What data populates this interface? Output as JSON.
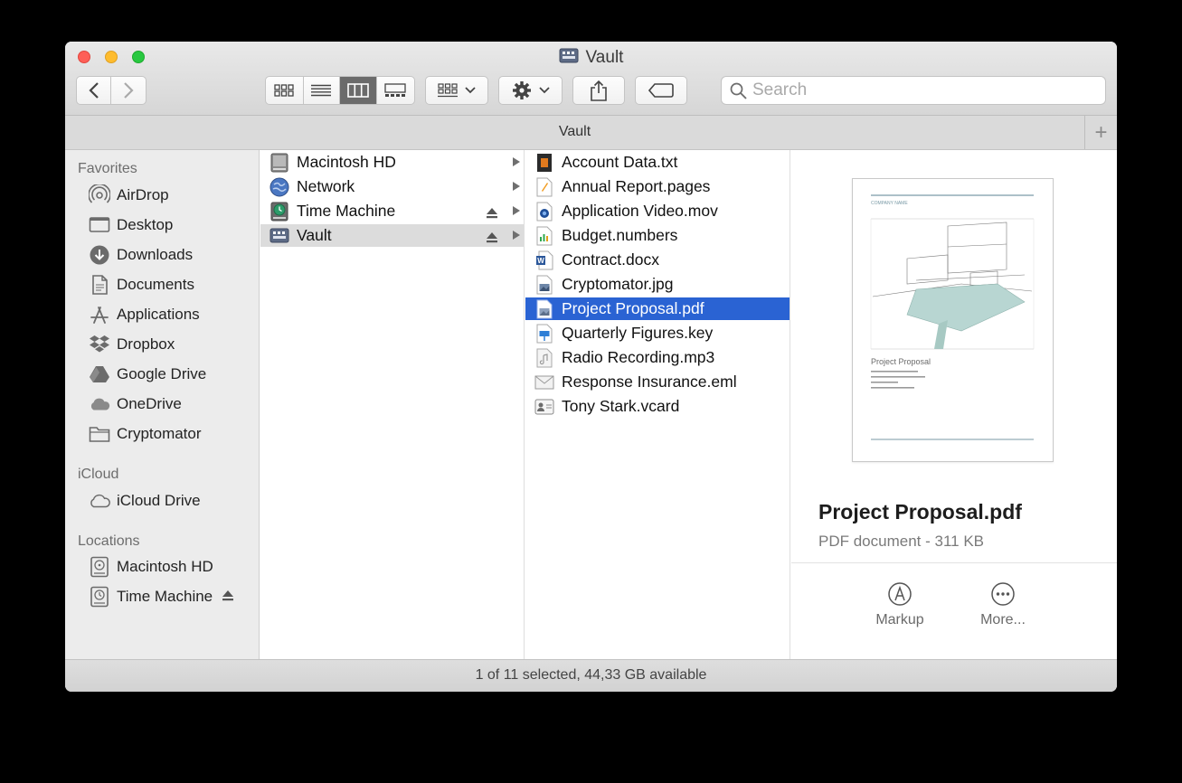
{
  "window": {
    "title": "Vault"
  },
  "toolbar": {
    "search_placeholder": "Search",
    "view_modes": [
      "icon-view",
      "list-view",
      "column-view",
      "gallery-view"
    ],
    "active_view": "column-view"
  },
  "pathbar": {
    "title": "Vault",
    "add_label": "+"
  },
  "sidebar": {
    "sections": [
      {
        "header": "Favorites",
        "items": [
          {
            "label": "AirDrop",
            "icon": "airdrop-icon"
          },
          {
            "label": "Desktop",
            "icon": "desktop-icon"
          },
          {
            "label": "Downloads",
            "icon": "downloads-icon"
          },
          {
            "label": "Documents",
            "icon": "documents-icon"
          },
          {
            "label": "Applications",
            "icon": "applications-icon"
          },
          {
            "label": "Dropbox",
            "icon": "dropbox-icon"
          },
          {
            "label": "Google Drive",
            "icon": "google-drive-icon"
          },
          {
            "label": "OneDrive",
            "icon": "onedrive-icon"
          },
          {
            "label": "Cryptomator",
            "icon": "folder-icon"
          }
        ]
      },
      {
        "header": "iCloud",
        "items": [
          {
            "label": "iCloud Drive",
            "icon": "icloud-icon"
          }
        ]
      },
      {
        "header": "Locations",
        "items": [
          {
            "label": "Macintosh HD",
            "icon": "hard-drive-icon"
          },
          {
            "label": "Time Machine",
            "icon": "time-machine-icon"
          }
        ]
      }
    ]
  },
  "columns": {
    "volumes": [
      {
        "label": "Macintosh HD",
        "icon": "hard-drive-icon",
        "eject": false
      },
      {
        "label": "Network",
        "icon": "network-icon",
        "eject": false
      },
      {
        "label": "Time Machine",
        "icon": "time-machine-icon",
        "eject": true
      },
      {
        "label": "Vault",
        "icon": "vault-drive-icon",
        "eject": true,
        "selected": true
      }
    ],
    "files": [
      {
        "label": "Account Data.txt",
        "icon": "text-file-icon"
      },
      {
        "label": "Annual Report.pages",
        "icon": "pages-file-icon"
      },
      {
        "label": "Application Video.mov",
        "icon": "video-file-icon"
      },
      {
        "label": "Budget.numbers",
        "icon": "numbers-file-icon"
      },
      {
        "label": "Contract.docx",
        "icon": "word-file-icon"
      },
      {
        "label": "Cryptomator.jpg",
        "icon": "image-file-icon"
      },
      {
        "label": "Project Proposal.pdf",
        "icon": "pdf-file-icon",
        "selected": true
      },
      {
        "label": "Quarterly Figures.key",
        "icon": "keynote-file-icon"
      },
      {
        "label": "Radio Recording.mp3",
        "icon": "audio-file-icon"
      },
      {
        "label": "Response Insurance.eml",
        "icon": "email-file-icon"
      },
      {
        "label": "Tony Stark.vcard",
        "icon": "vcard-file-icon"
      }
    ]
  },
  "preview": {
    "file_name": "Project Proposal.pdf",
    "meta": "PDF document - 311 KB",
    "thumb": {
      "company": "COMPANY NAME",
      "doc_title": "Project Proposal"
    },
    "actions": [
      {
        "label": "Markup",
        "icon": "markup-icon"
      },
      {
        "label": "More...",
        "icon": "more-icon"
      }
    ]
  },
  "status": {
    "text": "1 of 11 selected, 44,33 GB available"
  },
  "colors": {
    "selection_blue": "#2a63d3",
    "selection_grey": "#dcdcdc",
    "sidebar_bg": "#ececec"
  }
}
